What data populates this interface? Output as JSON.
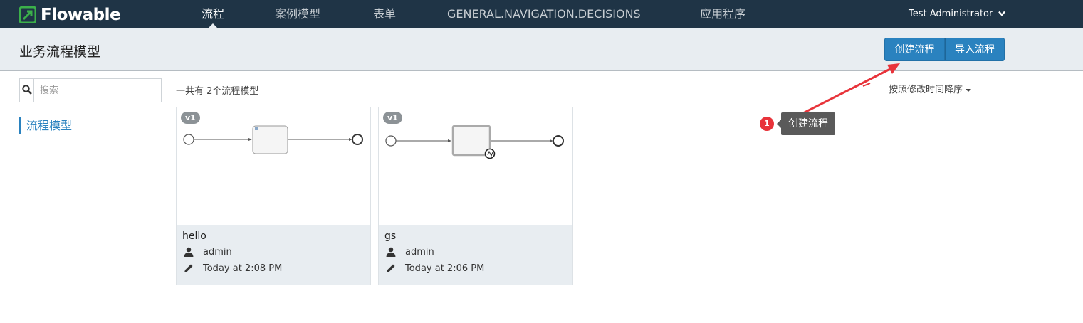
{
  "brand": {
    "name": "Flowable",
    "accent": "#2a82bf",
    "logo_color": "#3bb04a"
  },
  "nav": {
    "items": [
      {
        "label": "流程",
        "active": true
      },
      {
        "label": "案例模型",
        "active": false
      },
      {
        "label": "表单",
        "active": false
      },
      {
        "label": "GENERAL.NAVIGATION.DECISIONS",
        "active": false
      },
      {
        "label": "应用程序",
        "active": false
      }
    ],
    "user": "Test Administrator",
    "user_icon": "chevron-down-icon"
  },
  "header": {
    "title": "业务流程模型",
    "create_button": "创建流程",
    "import_button": "导入流程"
  },
  "sidebar": {
    "search": {
      "placeholder": "搜索",
      "value": ""
    },
    "items": [
      {
        "label": "流程模型",
        "active": true
      }
    ]
  },
  "main": {
    "count_text": "一共有 2个流程模型",
    "sort_label": "按照修改时间降序",
    "cards": [
      {
        "version": "v1",
        "name": "hello",
        "author": "admin",
        "modified": "Today at 2:08 PM"
      },
      {
        "version": "v1",
        "name": "gs",
        "author": "admin",
        "modified": "Today at 2:06 PM"
      }
    ]
  },
  "annotation": {
    "number": "1",
    "label": "创建流程",
    "color": "#e8333a"
  }
}
